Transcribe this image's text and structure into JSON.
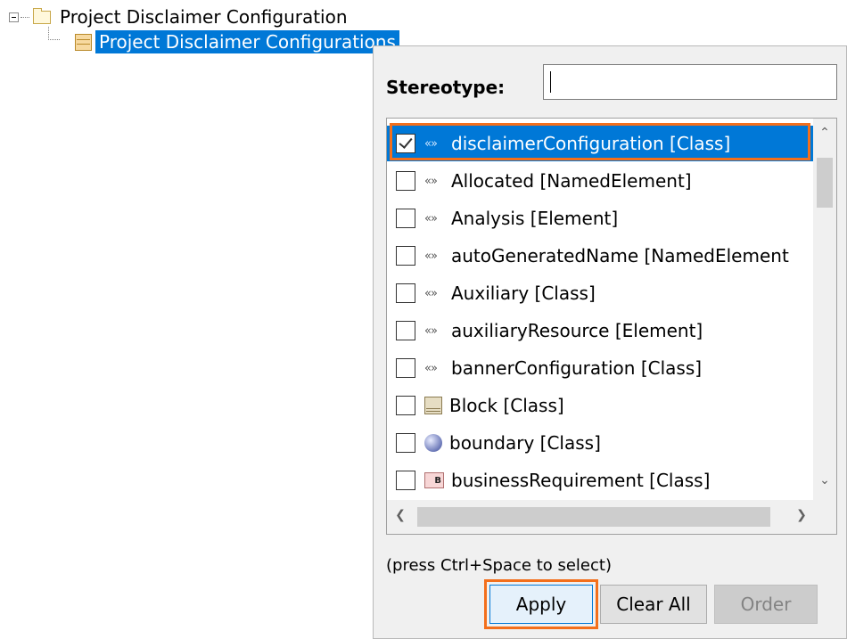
{
  "tree": {
    "root_label": "Project Disclaimer Configuration",
    "child_label": "Project Disclaimer Configurations"
  },
  "popup": {
    "stereotype_label": "Stereotype:",
    "search_value": "",
    "hint": "(press Ctrl+Space to select)",
    "items": [
      {
        "label": "disclaimerConfiguration [Class]",
        "checked": true,
        "icon": "stereotype-icon"
      },
      {
        "label": "Allocated [NamedElement]",
        "checked": false,
        "icon": "stereotype-icon"
      },
      {
        "label": "Analysis [Element]",
        "checked": false,
        "icon": "stereotype-icon"
      },
      {
        "label": "autoGeneratedName [NamedElement",
        "checked": false,
        "icon": "stereotype-icon"
      },
      {
        "label": "Auxiliary [Class]",
        "checked": false,
        "icon": "stereotype-icon"
      },
      {
        "label": "auxiliaryResource [Element]",
        "checked": false,
        "icon": "stereotype-icon"
      },
      {
        "label": "bannerConfiguration [Class]",
        "checked": false,
        "icon": "stereotype-icon"
      },
      {
        "label": "Block [Class]",
        "checked": false,
        "icon": "block-icon"
      },
      {
        "label": "boundary [Class]",
        "checked": false,
        "icon": "sphere-icon"
      },
      {
        "label": "businessRequirement [Class]",
        "checked": false,
        "icon": "requirement-icon"
      }
    ],
    "buttons": {
      "apply": "Apply",
      "clear_all": "Clear All",
      "order": "Order"
    },
    "icons": {
      "stereotype_glyph": "«»",
      "requirement_glyph": "B"
    },
    "colors": {
      "selection": "#0078d7",
      "highlight": "#f36f1c"
    }
  }
}
